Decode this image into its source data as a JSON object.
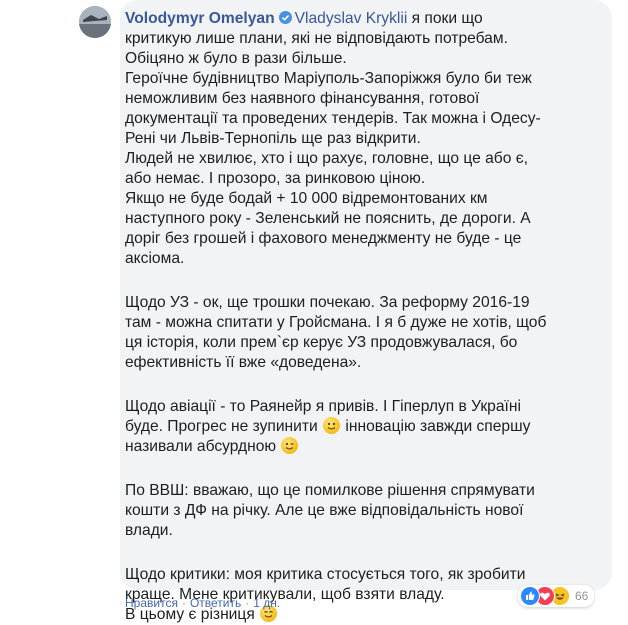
{
  "comment": {
    "author": "Volodymyr Omelyan",
    "mention": "Vladyslav Kryklii",
    "first_line_rest": " я поки що",
    "paragraphs": [
      [
        "критикую лише плани, які не відповідають потребам.",
        "Обіцяно ж було в рази більше.",
        "Героїчне будівництво Маріуполь-Запоріжжя було би теж",
        "неможливим без наявного фінансування, готової",
        "документації та проведених тендерів. Так можна і Одесу-",
        "Рені чи Львів-Тернопіль ще раз відкрити.",
        "Людей не хвилює, хто і що рахує, головне, що це або є,",
        "або немає. І прозоро, за ринковою ціною.",
        "Якщо не буде бодай + 10 000 відремонтованих км",
        "наступного року - Зеленський не пояснить, де дороги. А",
        "доріг без грошей і фахового менеджменту не буде - це",
        "аксіома."
      ],
      [
        "Щодо УЗ - ок, ще трошки почекаю. За реформу 2016-19",
        "там - можна спитати у Гройсмана. І я б дуже не хотів, щоб",
        "ця історія, коли прем`єр керує УЗ продовжувалася, бо",
        "ефективність її вже «доведена»."
      ],
      [
        "Щодо авіації - то Раянейр я привів. І Гіперлуп в Україні",
        "буде. Прогрес не зупинити",
        " інновацію завжди спершу",
        "називали абсурдною"
      ],
      [
        "По ВВШ: вважаю, що це помилкове рішення спрямувати",
        "кошти з ДФ на річку. Але це вже відповідальність нової",
        "влади."
      ],
      [
        "Щодо критики: моя критика стосується того, як зробити",
        "краще. Мене критикували, щоб взяти владу.",
        "В цьому є різниця"
      ]
    ]
  },
  "actions": {
    "like": "Нравится",
    "reply": "Ответить",
    "time": "1 дн.",
    "separator": "·"
  },
  "reactions": {
    "count": "66",
    "types": [
      "like-icon",
      "love-icon",
      "haha-icon"
    ]
  },
  "colors": {
    "author": "#385898",
    "bubble": "#f2f3f5",
    "meta": "#90949c",
    "link": "#4267b2"
  }
}
